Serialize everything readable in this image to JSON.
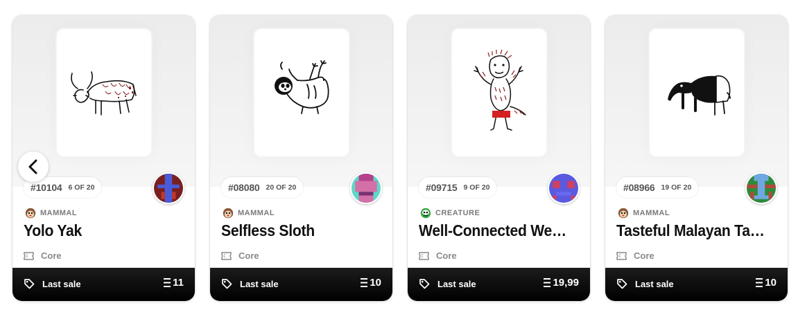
{
  "navigation": {
    "prev_icon": "chevron-left-icon"
  },
  "cards": [
    {
      "serial": "#10104",
      "edition": "6 OF 20",
      "category": "MAMMAL",
      "category_icon": "mammal-icon",
      "name": "Yolo Yak",
      "tier": "Core",
      "tier_icon": "ticket-icon",
      "sale_label": "Last sale",
      "price": "11",
      "currency_icon": "eth-icon",
      "artwork": "yak-drawing",
      "avatar_colors": [
        "#7a1f1f",
        "#4a5bd8",
        "#c0392b"
      ]
    },
    {
      "serial": "#08080",
      "edition": "20 OF 20",
      "category": "MAMMAL",
      "category_icon": "mammal-icon",
      "name": "Selfless Sloth",
      "tier": "Core",
      "tier_icon": "ticket-icon",
      "sale_label": "Last sale",
      "price": "10",
      "currency_icon": "eth-icon",
      "artwork": "sloth-drawing",
      "avatar_colors": [
        "#5ed8c8",
        "#d46fa8",
        "#b6408a"
      ]
    },
    {
      "serial": "#09715",
      "edition": "9 OF 20",
      "category": "CREATURE",
      "category_icon": "creature-icon",
      "name": "Well-Connected Were...",
      "tier": "Core",
      "tier_icon": "ticket-icon",
      "sale_label": "Last sale",
      "price": "19,99",
      "currency_icon": "eth-icon",
      "artwork": "werewolf-drawing",
      "avatar_colors": [
        "#5a5ae0",
        "#d04060",
        "#6a6af0"
      ]
    },
    {
      "serial": "#08966",
      "edition": "19 OF 20",
      "category": "MAMMAL",
      "category_icon": "mammal-icon",
      "name": "Tasteful Malayan Tapir",
      "tier": "Core",
      "tier_icon": "ticket-icon",
      "sale_label": "Last sale",
      "price": "10",
      "currency_icon": "eth-icon",
      "artwork": "tapir-drawing",
      "avatar_colors": [
        "#2f8a3a",
        "#6fa8e0",
        "#b04a3a"
      ]
    }
  ]
}
